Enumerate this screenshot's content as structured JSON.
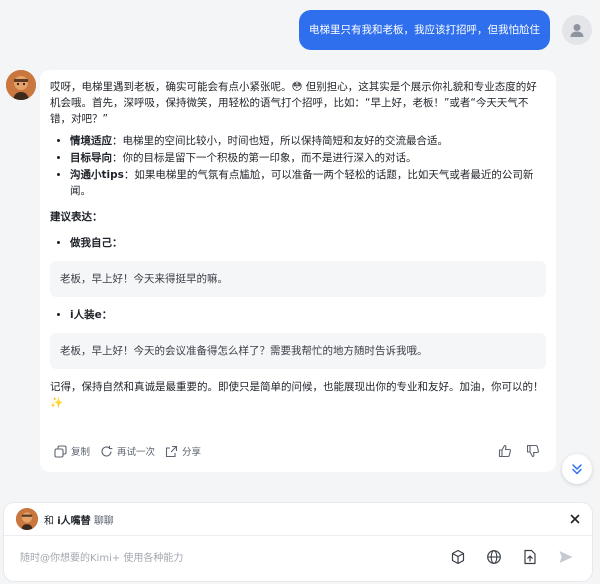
{
  "user_message": "电梯里只有我和老板，我应该打招呼，但我怕尬住",
  "assistant": {
    "intro": "哎呀，电梯里遇到老板，确实可能会有点小紧张呢。😳 但别担心，这其实是个展示你礼貌和专业态度的好机会哦。首先，深呼吸，保持微笑，用轻松的语气打个招呼，比如：“早上好，老板！”或者“今天天气不错，对吧？”",
    "bullets": [
      {
        "term": "情境适应",
        "text": "：电梯里的空间比较小，时间也短，所以保持简短和友好的交流最合适。"
      },
      {
        "term": "目标导向",
        "text": "：你的目标是留下一个积极的第一印象，而不是进行深入的对话。"
      },
      {
        "term": "沟通小tips",
        "text": "：如果电梯里的气氛有点尴尬，可以准备一两个轻松的话题，比如天气或者最近的公司新闻。"
      }
    ],
    "suggest_heading": "建议表达：",
    "option1_label": "做我自己：",
    "option1_quote": "老板，早上好！今天来得挺早的嘛。",
    "option2_label": "i人装e：",
    "option2_quote": "老板，早上好！今天的会议准备得怎么样了？需要我帮忙的地方随时告诉我哦。",
    "closing": "记得，保持自然和真诚是最重要的。即使只是简单的问候，也能展现出你的专业和友好。加油，你可以的！✨"
  },
  "actions": {
    "copy": "复制",
    "retry": "再试一次",
    "share": "分享"
  },
  "composer": {
    "prefix": "和",
    "bot_name": "i人嘴替",
    "suffix": "聊聊",
    "placeholder": "随时@你想要的Kimi+ 使用各种能力"
  },
  "colors": {
    "accent": "#2f6fed",
    "background": "#f4f5f7"
  }
}
